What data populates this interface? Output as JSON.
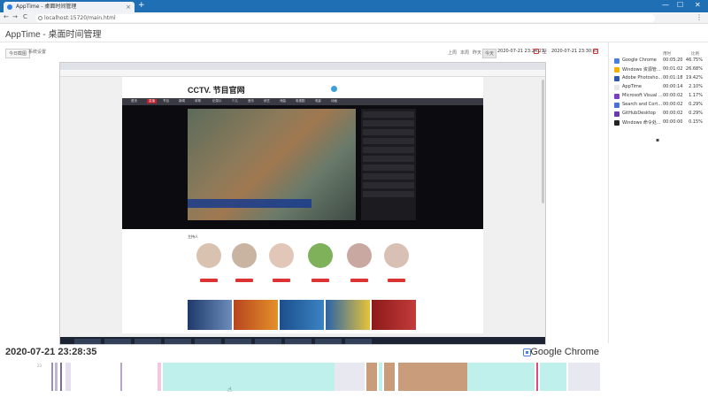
{
  "browser": {
    "tab_title": "AppTime - 桌面时间管理",
    "tab_close": "×",
    "new_tab": "+",
    "url": "localhost:15720/main.html",
    "win_min": "—",
    "win_max": "☐",
    "win_close": "✕",
    "nav_back": "←",
    "nav_forward": "→",
    "nav_reload": "C",
    "menu": "⋮"
  },
  "app": {
    "title": "AppTime - 桌面时间管理",
    "buttons": {
      "today_screenshot": "今日截图",
      "settings": "系统设置"
    },
    "ranges": [
      {
        "label": "上周",
        "active": false
      },
      {
        "label": "本周",
        "active": false
      },
      {
        "label": "昨天",
        "active": false
      },
      {
        "label": "今天",
        "active": true
      }
    ],
    "date_from": "2020-07-21 23:24:21",
    "date_to": "2020-07-21 23:30:45",
    "date_sep": "至"
  },
  "screenshot": {
    "site_logo": "CCTV. 节目官网",
    "nav_items": [
      "首页",
      "直播",
      "节目",
      "新闻",
      "体育",
      "纪录片",
      "少儿",
      "音乐",
      "综艺",
      "戏曲",
      "电视剧",
      "电影",
      "动画"
    ],
    "section_hosts": "主持人"
  },
  "stats": {
    "header": {
      "app": "",
      "duration": "用时",
      "percent": "比例"
    },
    "items": [
      {
        "name": "Google Chrome",
        "time": "00:05:20",
        "percent": "46.75%",
        "color": "#4a7ee0"
      },
      {
        "name": "Windows 资源管...",
        "time": "00:01:02",
        "percent": "26.68%",
        "color": "#f0b400"
      },
      {
        "name": "Adobe Photosho...",
        "time": "00:01:18",
        "percent": "19.42%",
        "color": "#2d5aa8"
      },
      {
        "name": "AppTime",
        "time": "00:00:14",
        "percent": "2.10%",
        "color": "#e8e8e8"
      },
      {
        "name": "Microsoft Visual ...",
        "time": "00:00:02",
        "percent": "1.17%",
        "color": "#7b3fc4"
      },
      {
        "name": "Search and Cort...",
        "time": "00:00:02",
        "percent": "0.29%",
        "color": "#4a6fd8"
      },
      {
        "name": "GitHubDesktop",
        "time": "00:00:02",
        "percent": "0.29%",
        "color": "#6a3aa8"
      },
      {
        "name": "Windows 命令处...",
        "time": "00:00:00",
        "percent": "0.15%",
        "color": "#222222"
      }
    ]
  },
  "footer": {
    "timestamp": "2020-07-21 23:28:35",
    "current_app": "Google Chrome",
    "timeline_start_label": "23"
  }
}
